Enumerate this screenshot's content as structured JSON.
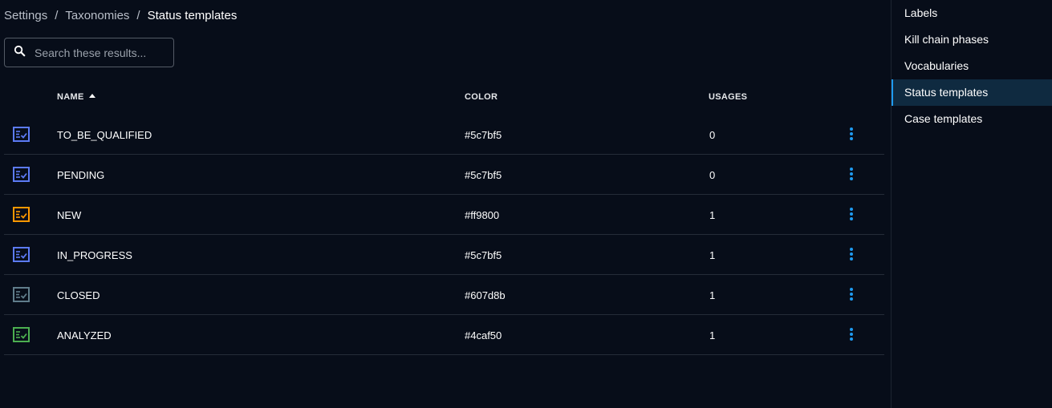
{
  "breadcrumb": {
    "root": "Settings",
    "middle": "Taxonomies",
    "current": "Status templates",
    "separator": "/"
  },
  "search": {
    "placeholder": "Search these results..."
  },
  "table": {
    "headers": {
      "name": "NAME",
      "color": "COLOR",
      "usages": "USAGES"
    },
    "rows": [
      {
        "name": "TO_BE_QUALIFIED",
        "color": "#5c7bf5",
        "usages": "0"
      },
      {
        "name": "PENDING",
        "color": "#5c7bf5",
        "usages": "0"
      },
      {
        "name": "NEW",
        "color": "#ff9800",
        "usages": "1"
      },
      {
        "name": "IN_PROGRESS",
        "color": "#5c7bf5",
        "usages": "1"
      },
      {
        "name": "CLOSED",
        "color": "#607d8b",
        "usages": "1"
      },
      {
        "name": "ANALYZED",
        "color": "#4caf50",
        "usages": "1"
      }
    ]
  },
  "sidebar": {
    "items": [
      {
        "label": "Labels",
        "active": false
      },
      {
        "label": "Kill chain phases",
        "active": false
      },
      {
        "label": "Vocabularies",
        "active": false
      },
      {
        "label": "Status templates",
        "active": true
      },
      {
        "label": "Case templates",
        "active": false
      }
    ]
  },
  "icons": {
    "row_icon": "list-check-icon",
    "search": "search-icon",
    "row_menu": "more-vert-icon"
  },
  "colors": {
    "accent": "#1f9bf0",
    "background": "#070d19"
  }
}
